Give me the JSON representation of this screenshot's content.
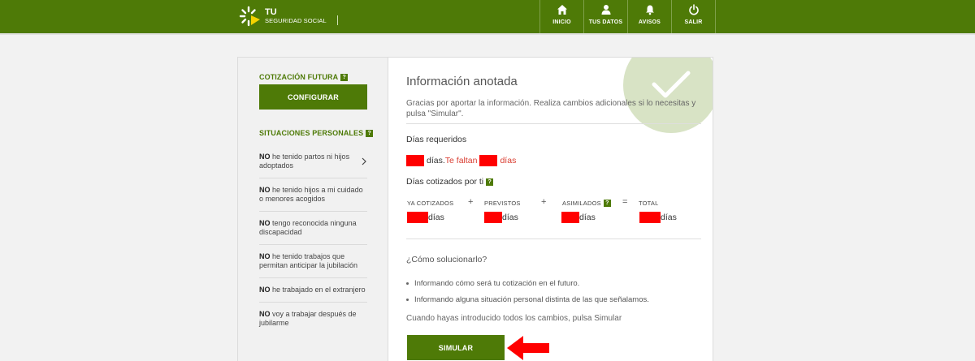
{
  "header": {
    "brand_tu": "TU",
    "brand_sub": "SEGURIDAD SOCIAL",
    "nav": [
      {
        "label": "INICIO",
        "icon": "home-icon"
      },
      {
        "label": "TUS DATOS",
        "icon": "user-icon"
      },
      {
        "label": "AVISOS",
        "icon": "bell-icon"
      },
      {
        "label": "SALIR",
        "icon": "power-icon"
      }
    ],
    "colors": {
      "brand": "#4e7a07",
      "logo_yellow": "#f5d300"
    }
  },
  "sidebar": {
    "cotizacion_title": "COTIZACIÓN FUTURA",
    "help_badge": "?",
    "configurar_label": "CONFIGURAR",
    "situaciones_title": "SITUACIONES PERSONALES",
    "situaciones": [
      {
        "neg": "NO",
        "text": " he tenido partos ni hijos adoptados",
        "chevron": true
      },
      {
        "neg": "NO",
        "text": " he tenido hijos a mi cuidado o menores acogidos"
      },
      {
        "neg": "NO",
        "text": " tengo reconocida ninguna discapacidad"
      },
      {
        "neg": "NO",
        "text": " he tenido trabajos que permitan anticipar la jubilación"
      },
      {
        "neg": "NO",
        "text": " he trabajado en el extranjero"
      },
      {
        "neg": "NO",
        "text": " voy a trabajar después de jubilarme"
      }
    ]
  },
  "main": {
    "title": "Información anotada",
    "description": "Gracias por aportar la información. Realiza cambios adicionales si lo necesitas y pulsa \"Simular\".",
    "dias_requeridos_label": "Días requeridos",
    "req_days_unit": "días.",
    "te_faltan": "Te faltan",
    "req_missing_unit": "días",
    "dias_cotizados_label": "Días cotizados por ti",
    "columns": [
      {
        "label": "YA COTIZADOS",
        "unit": "días"
      },
      {
        "label": "PREVISTOS",
        "unit": "días"
      },
      {
        "label": "ASIMILADOS",
        "unit": "días",
        "help": true
      },
      {
        "label": "TOTAL",
        "unit": "días"
      }
    ],
    "operators": [
      "+",
      "+",
      "="
    ],
    "how_title": "¿Cómo solucionarlo?",
    "bullets": [
      "Informando cómo será tu cotización en el futuro.",
      "Informando alguna situación personal distinta de las que señalamos."
    ],
    "final_text": "Cuando hayas introducido todos los cambios, pulsa Simular",
    "simular_label": "SIMULAR"
  }
}
